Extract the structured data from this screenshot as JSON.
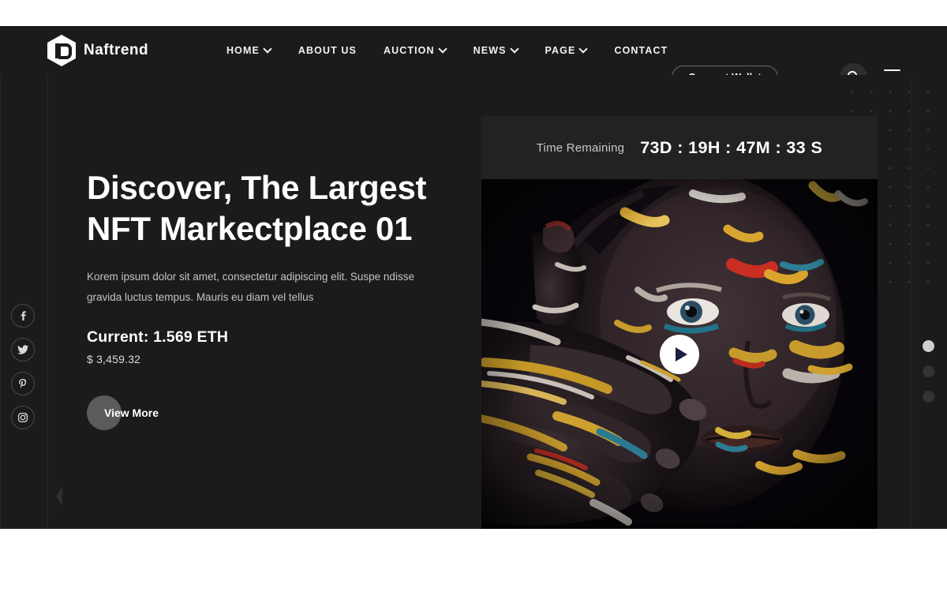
{
  "brand": {
    "name": "Naftrend",
    "logo_icon": "hexagon-d-logo-icon"
  },
  "nav": {
    "items": [
      {
        "label": "HOME",
        "has_dropdown": true
      },
      {
        "label": "ABOUT US",
        "has_dropdown": false
      },
      {
        "label": "AUCTION",
        "has_dropdown": true
      },
      {
        "label": "NEWS",
        "has_dropdown": true
      },
      {
        "label": "PAGE",
        "has_dropdown": true
      },
      {
        "label": "CONTACT",
        "has_dropdown": false
      }
    ]
  },
  "header_actions": {
    "wallet_label": "Connect Wallet",
    "search_icon": "search-icon",
    "menu_icon": "hamburger-menu-icon"
  },
  "hero": {
    "headline_line1": "Discover, The Largest",
    "headline_line2": "NFT Markectplace 01",
    "description": "Korem ipsum dolor sit amet, consectetur adipiscing elit. Suspe ndisse gravida luctus tempus. Mauris eu diam vel tellus",
    "current_price": "Current: 1.569 ETH",
    "usd_price": "$ 3,459.32",
    "cta_label": "View More",
    "prev_arrow_icon": "chevron-left-icon",
    "circuit_decoration_icon": "circuit-lines-decoration-icon",
    "dot_grid_icon": "dot-grid-decoration-icon"
  },
  "media": {
    "timer_label": "Time Remaining",
    "timer_value": "73D : 19H : 47M : 33 S",
    "play_icon": "play-icon",
    "image_alt": "portrait-with-body-paint"
  },
  "socials": [
    {
      "name": "facebook",
      "glyph": "f"
    },
    {
      "name": "twitter",
      "glyph": "twitter-bird"
    },
    {
      "name": "pinterest",
      "glyph": "P"
    },
    {
      "name": "instagram",
      "glyph": "instagram-camera"
    }
  ],
  "slider": {
    "dots": [
      {
        "active": true
      },
      {
        "active": false
      },
      {
        "active": false
      }
    ]
  },
  "colors": {
    "background": "#1b1b1b",
    "header": "#1b1b1b",
    "timer_bar": "#222222",
    "accent_light": "#ffffff",
    "cta_circle": "#5b5b5b",
    "active_dot": "#cfcfcf",
    "inactive_dot": "#333333",
    "page_outer": "#ffffff"
  }
}
